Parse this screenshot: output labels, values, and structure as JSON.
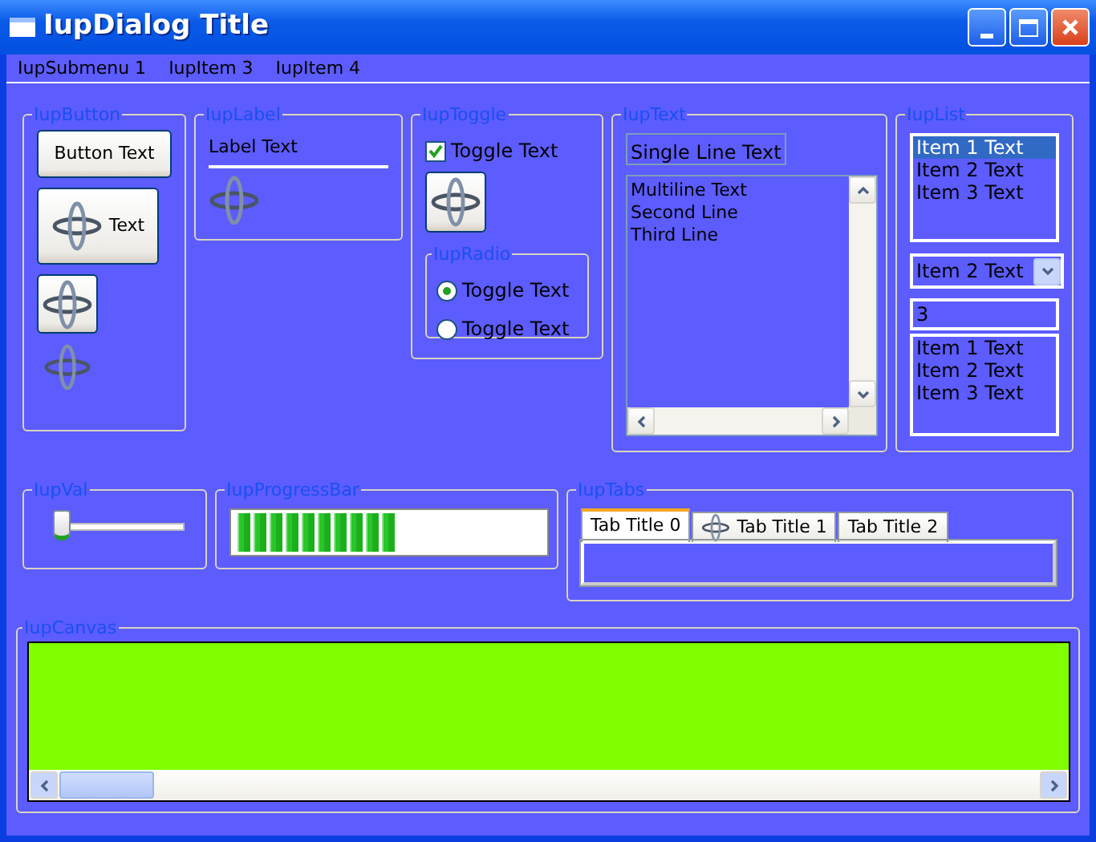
{
  "window": {
    "title": "IupDialog Title"
  },
  "menu": [
    {
      "label": "IupSubmenu 1"
    },
    {
      "label": "IupItem 3"
    },
    {
      "label": "IupItem 4"
    }
  ],
  "button_frame": {
    "title": "IupButton",
    "text_button": "Button Text",
    "icon_text_button": "Text"
  },
  "label_frame": {
    "title": "IupLabel",
    "label": "Label Text"
  },
  "toggle_frame": {
    "title": "IupToggle",
    "toggle": {
      "label": "Toggle Text",
      "checked": true
    },
    "radio": {
      "title": "IupRadio",
      "options": [
        {
          "label": "Toggle Text",
          "selected": true
        },
        {
          "label": "Toggle Text",
          "selected": false
        }
      ]
    }
  },
  "text_frame": {
    "title": "IupText",
    "single_line": "Single Line Text",
    "multiline": [
      "Multiline Text",
      "Second Line",
      "Third Line"
    ]
  },
  "list_frame": {
    "title": "IupList",
    "list": [
      {
        "label": "Item 1 Text",
        "selected": true
      },
      {
        "label": "Item 2 Text",
        "selected": false
      },
      {
        "label": "Item 3 Text",
        "selected": false
      }
    ],
    "dropdown": {
      "value": "Item 2 Text"
    },
    "edit_list": {
      "value": "3",
      "items": [
        {
          "label": "Item 1 Text"
        },
        {
          "label": "Item 2 Text"
        },
        {
          "label": "Item 3 Text"
        }
      ]
    }
  },
  "val_frame": {
    "title": "IupVal",
    "level": 0
  },
  "progress_frame": {
    "title": "IupProgressBar",
    "level": 0.53
  },
  "tabs_frame": {
    "title": "IupTabs",
    "tabs": [
      {
        "label": "Tab Title 0",
        "selected": true,
        "icon": false
      },
      {
        "label": "Tab Title 1",
        "selected": false,
        "icon": true
      },
      {
        "label": "Tab Title 2",
        "selected": false,
        "icon": false
      }
    ]
  },
  "canvas_frame": {
    "title": "IupCanvas"
  }
}
